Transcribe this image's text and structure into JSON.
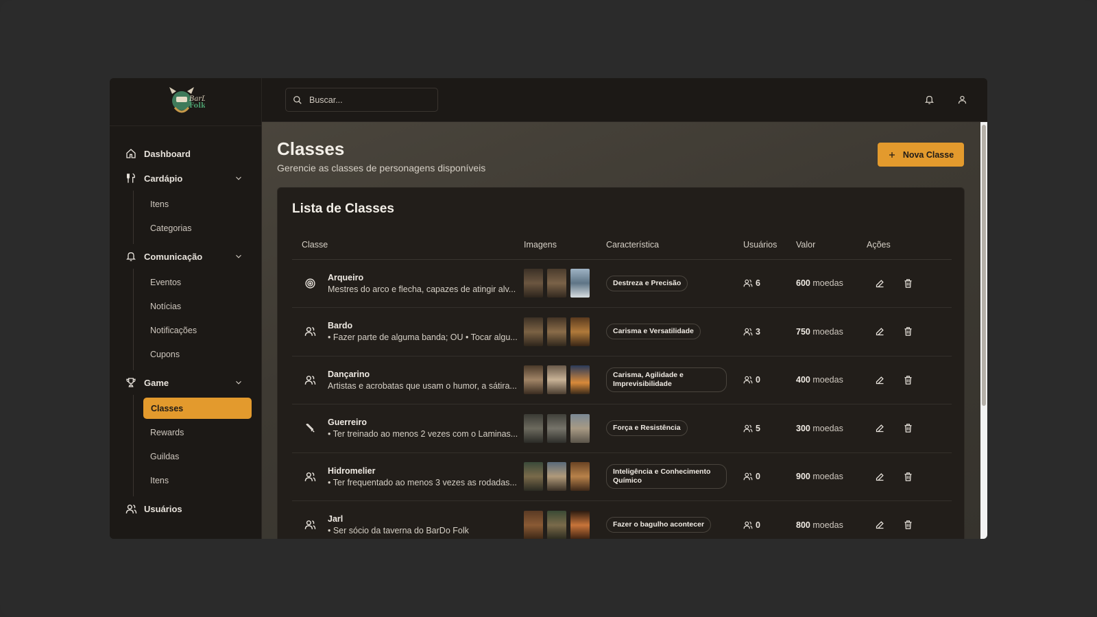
{
  "brand": {
    "logo_text": "BarDo Folk"
  },
  "sidebar": {
    "items": [
      {
        "label": "Dashboard",
        "icon": "home-icon"
      },
      {
        "label": "Cardápio",
        "icon": "utensils-icon",
        "children": [
          "Itens",
          "Categorias"
        ]
      },
      {
        "label": "Comunicação",
        "icon": "bell-icon",
        "children": [
          "Eventos",
          "Notícias",
          "Notificações",
          "Cupons"
        ]
      },
      {
        "label": "Game",
        "icon": "trophy-icon",
        "children": [
          "Classes",
          "Rewards",
          "Guildas",
          "Itens"
        ]
      },
      {
        "label": "Usuários",
        "icon": "users-icon"
      }
    ],
    "active": "Classes"
  },
  "topbar": {
    "search_placeholder": "Buscar..."
  },
  "page": {
    "title": "Classes",
    "subtitle": "Gerencie as classes de personagens disponíveis",
    "new_button": "Nova Classe"
  },
  "card": {
    "title": "Lista de Classes",
    "columns": [
      "Classe",
      "Imagens",
      "Característica",
      "Usuários",
      "Valor",
      "Ações"
    ],
    "rows": [
      {
        "name": "Arqueiro",
        "desc": "Mestres do arco e flecha, capazes de atingir alv...",
        "trait": "Destreza e Precisão",
        "users": "6",
        "value": "600",
        "unit": "moedas",
        "icon": "target-icon"
      },
      {
        "name": "Bardo",
        "desc": "• Fazer parte de alguma banda; OU • Tocar algu...",
        "trait": "Carisma e Versatilidade",
        "users": "3",
        "value": "750",
        "unit": "moedas",
        "icon": "users-icon"
      },
      {
        "name": "Dançarino",
        "desc": "Artistas e acrobatas que usam o humor, a sátira...",
        "trait": "Carisma, Agilidade e Imprevisibilidade",
        "users": "0",
        "value": "400",
        "unit": "moedas",
        "icon": "users-icon"
      },
      {
        "name": "Guerreiro",
        "desc": "• Ter treinado ao menos 2 vezes com o Laminas...",
        "trait": "Força e Resistência",
        "users": "5",
        "value": "300",
        "unit": "moedas",
        "icon": "sword-icon"
      },
      {
        "name": "Hidromelier",
        "desc": "• Ter frequentado ao menos 3 vezes as rodadas...",
        "trait": "Inteligência e Conhecimento Químico",
        "users": "0",
        "value": "900",
        "unit": "moedas",
        "icon": "users-icon"
      },
      {
        "name": "Jarl",
        "desc": "• Ser sócio da taverna do BarDo Folk",
        "trait": "Fazer o bagulho acontecer",
        "users": "0",
        "value": "800",
        "unit": "moedas",
        "icon": "users-icon"
      }
    ]
  },
  "colors": {
    "accent": "#e39a2d",
    "sidebar_bg": "#1c1916",
    "card_bg": "#221e1a"
  }
}
